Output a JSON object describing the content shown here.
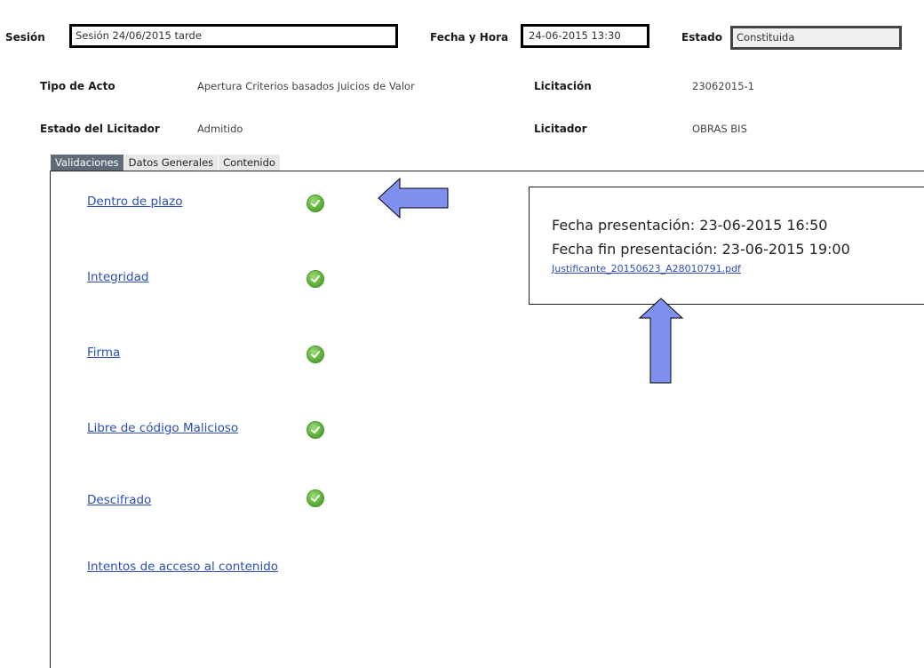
{
  "header": {
    "sesion_label": "Sesión",
    "sesion_value": "Sesión 24/06/2015 tarde",
    "fecha_label": "Fecha y Hora",
    "fecha_value": "24-06-2015 13:30",
    "estado_label": "Estado",
    "estado_value": "Constituida"
  },
  "info": {
    "tipo_acto_label": "Tipo de Acto",
    "tipo_acto_value": "Apertura Criterios basados Juicios de Valor",
    "licitacion_label": "Licitación",
    "licitacion_value": "23062015-1",
    "estado_licitador_label": "Estado del Licitador",
    "estado_licitador_value": "Admitido",
    "licitador_label": "Licitador",
    "licitador_value": "OBRAS BIS"
  },
  "tabs": [
    {
      "label": "Validaciones",
      "active": true
    },
    {
      "label": "Datos Generales",
      "active": false
    },
    {
      "label": "Contenido",
      "active": false
    }
  ],
  "validations": [
    {
      "label": "Dentro de plazo",
      "ok": true
    },
    {
      "label": "Integridad",
      "ok": true
    },
    {
      "label": "Firma",
      "ok": true
    },
    {
      "label": "Libre de código Malicioso",
      "ok": true
    },
    {
      "label": "Descifrado",
      "ok": true
    },
    {
      "label": "Intentos de acceso al contenido",
      "ok": false
    }
  ],
  "presentation": {
    "fecha_presentacion": "Fecha presentación: 23-06-2015 16:50",
    "fecha_fin": "Fecha fin presentación: 23-06-2015 19:00",
    "justificante": "Justificante_20150623_A28010791.pdf"
  },
  "colors": {
    "arrow": "#8090f0",
    "check": "#5fb33c",
    "link": "#2a4fb8"
  }
}
